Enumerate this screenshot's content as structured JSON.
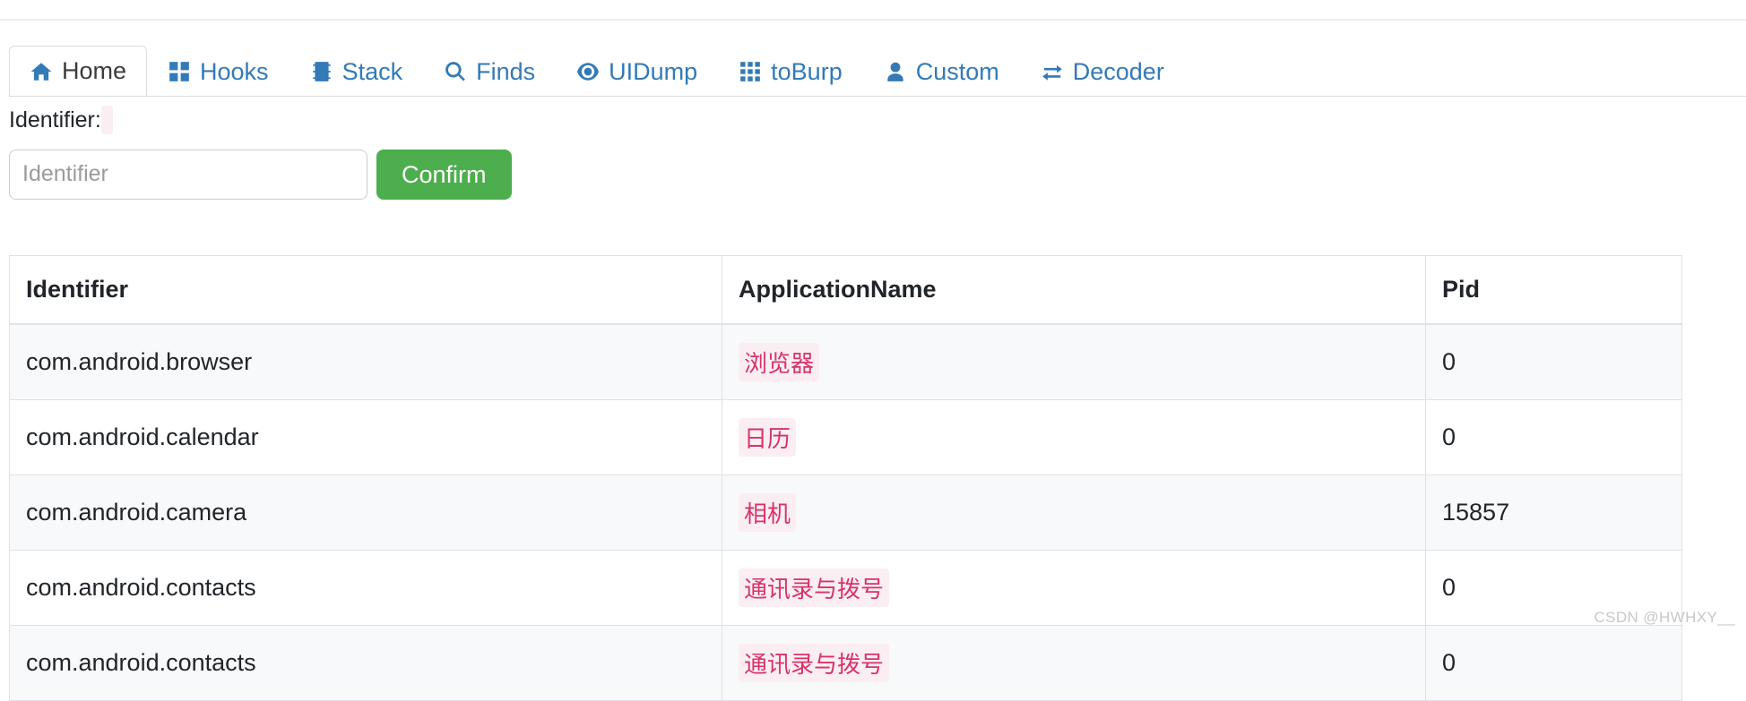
{
  "tabs": [
    {
      "label": "Home",
      "icon": "home-icon",
      "active": true
    },
    {
      "label": "Hooks",
      "icon": "grid-2x2-icon",
      "active": false
    },
    {
      "label": "Stack",
      "icon": "layers-icon",
      "active": false
    },
    {
      "label": "Finds",
      "icon": "search-icon",
      "active": false
    },
    {
      "label": "UIDump",
      "icon": "eye-icon",
      "active": false
    },
    {
      "label": "toBurp",
      "icon": "grid-3x3-icon",
      "active": false
    },
    {
      "label": "Custom",
      "icon": "user-icon",
      "active": false
    },
    {
      "label": "Decoder",
      "icon": "exchange-icon",
      "active": false
    }
  ],
  "form": {
    "label": "Identifier:",
    "input_value": "",
    "input_placeholder": "Identifier",
    "confirm_label": "Confirm"
  },
  "table": {
    "columns": [
      "Identifier",
      "ApplicationName",
      "Pid"
    ],
    "rows": [
      {
        "identifier": "com.android.browser",
        "application_name": "浏览器",
        "pid": "0"
      },
      {
        "identifier": "com.android.calendar",
        "application_name": "日历",
        "pid": "0"
      },
      {
        "identifier": "com.android.camera",
        "application_name": "相机",
        "pid": "15857"
      },
      {
        "identifier": "com.android.contacts",
        "application_name": "通讯录与拨号",
        "pid": "0"
      },
      {
        "identifier": "com.android.contacts",
        "application_name": "通讯录与拨号",
        "pid": "0"
      }
    ]
  },
  "watermark": "CSDN @HWHXY__",
  "colors": {
    "tab_link": "#337ab7",
    "tab_active_text": "#3b3b3b",
    "confirm_green": "#4cae4c",
    "code_pink_text": "#d6336c",
    "code_pink_bg": "#fbeef2",
    "row_stripe": "#f8f9fa",
    "border": "#dee2e6"
  }
}
